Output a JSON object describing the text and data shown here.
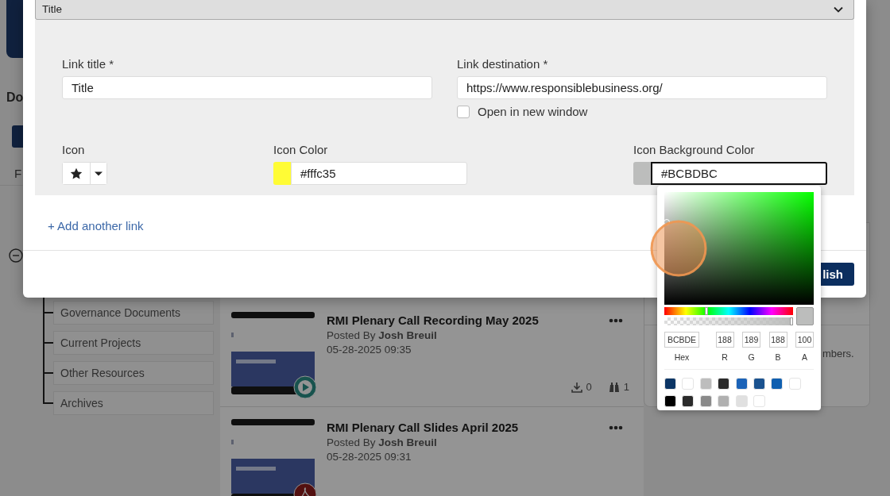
{
  "background": {
    "sidebar": {
      "heading": "Do",
      "tab": "F",
      "tree": [
        {
          "label": "Governance Documents"
        },
        {
          "label": "Current Projects"
        },
        {
          "label": "Other Resources"
        },
        {
          "label": "Archives"
        }
      ]
    },
    "posts": [
      {
        "kind": "video",
        "title": "RMI Plenary Call Recording May 2025",
        "byline": "Posted By **Josh Breuil**",
        "date": "05-28-2025 09:35",
        "downloads": "0",
        "views": "1"
      },
      {
        "kind": "pdf",
        "title": "RMI Plenary Call Slides April 2025",
        "byline": "Posted By **Josh Breuil**",
        "date": "05-28-2025 09:31"
      }
    ],
    "side_card": {
      "text": "mbers."
    }
  },
  "modal": {
    "section": {
      "title": "Title",
      "expanded": true
    },
    "link_title": {
      "label": "Link title *",
      "value": "Title"
    },
    "link_destination": {
      "label": "Link destination *",
      "value": "https://www.responsiblebusiness.org/"
    },
    "open_in_new_window": {
      "label": "Open in new window",
      "checked": false
    },
    "icon": {
      "label": "Icon"
    },
    "icon_color": {
      "label": "Icon Color",
      "value": "#fffc35",
      "color": "#fffc35"
    },
    "icon_background_color": {
      "label": "Icon Background Color",
      "value": "#BCBDBC",
      "color": "#bcbdbc",
      "focused": true
    },
    "add_link": "+ Add another link",
    "publish_button": "lish"
  },
  "color_picker": {
    "hue": {
      "level": 0.33
    },
    "alpha": {
      "level": 1
    },
    "fields": [
      {
        "label": "Hex",
        "value": "BCBDE"
      },
      {
        "label": "R",
        "value": "188"
      },
      {
        "label": "G",
        "value": "189"
      },
      {
        "label": "B",
        "value": "188"
      },
      {
        "label": "A",
        "value": "100"
      }
    ],
    "swatch_rows": [
      [
        {
          "color": "#0b3565"
        },
        {
          "color": "#ffffff"
        },
        {
          "color": "#bdbdbd"
        },
        {
          "color": "#2a2a2a"
        },
        {
          "color": "#1b63b8"
        },
        {
          "color": "#1a528f"
        },
        {
          "color": "#0f5fb0"
        },
        {
          "color": "#ffffff"
        }
      ],
      [
        {
          "color": "#000000"
        },
        {
          "color": "#2b2b2b"
        },
        {
          "color": "#8a8a8a"
        },
        {
          "color": "#b0b0b0"
        },
        {
          "color": "#e0e0e0"
        },
        {
          "color": "#ffffff"
        }
      ]
    ]
  }
}
